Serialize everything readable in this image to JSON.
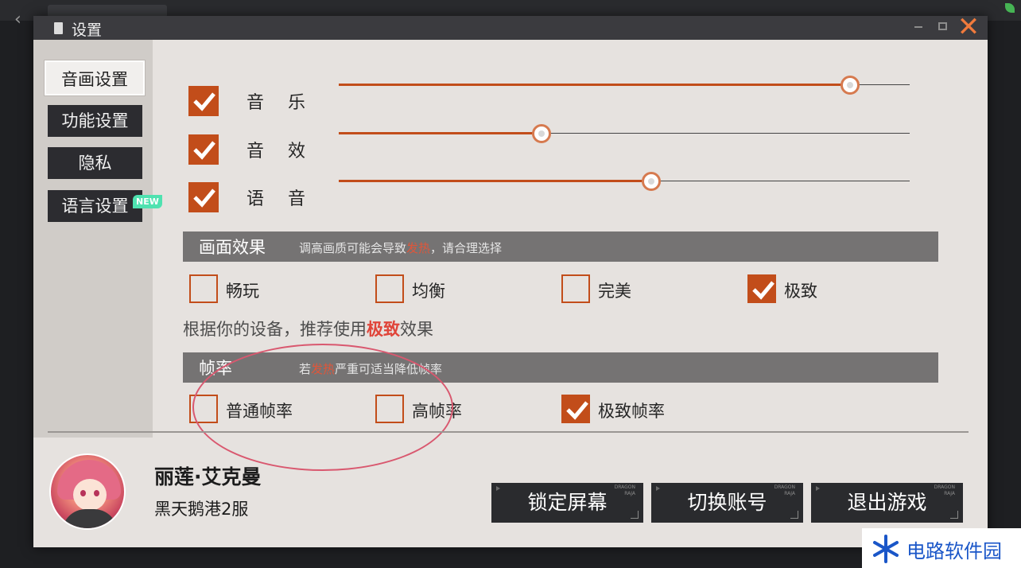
{
  "window": {
    "title": "设置"
  },
  "sidebar": {
    "items": [
      {
        "label": "音画设置",
        "active": true
      },
      {
        "label": "功能设置",
        "active": false
      },
      {
        "label": "隐私",
        "active": false
      },
      {
        "label": "语言设置",
        "active": false
      }
    ],
    "new_badge": "NEW"
  },
  "volume": [
    {
      "label": "音乐",
      "checked": true,
      "level": 0.895
    },
    {
      "label": "音效",
      "checked": true,
      "level": 0.355
    },
    {
      "label": "语音",
      "checked": true,
      "level": 0.548
    }
  ],
  "quality": {
    "title": "画面效果",
    "hint_before": "调高画质可能会导致",
    "hint_hot": "发热",
    "hint_after": "，请合理选择",
    "options": [
      {
        "label": "畅玩",
        "checked": false
      },
      {
        "label": "均衡",
        "checked": false
      },
      {
        "label": "完美",
        "checked": false
      },
      {
        "label": "极致",
        "checked": true
      }
    ],
    "recommend_before": "根据你的设备，推荐使用",
    "recommend_highlight": "极致",
    "recommend_after": "效果"
  },
  "framerate": {
    "title": "帧率",
    "hint_before": "若",
    "hint_hot": "发热",
    "hint_after": "严重可适当降低帧率",
    "options": [
      {
        "label": "普通帧率",
        "checked": false
      },
      {
        "label": "高帧率",
        "checked": false
      },
      {
        "label": "极致帧率",
        "checked": true
      }
    ]
  },
  "profile": {
    "name": "丽莲·艾克曼",
    "server": "黑天鹅港2服"
  },
  "buttons": {
    "lock_screen": "锁定屏幕",
    "switch_account": "切换账号",
    "exit_game": "退出游戏",
    "brand_line1": "DRAGON",
    "brand_line2": "RAJA"
  },
  "watermark": {
    "text": "电路软件园"
  },
  "colors": {
    "accent": "#c24d1a",
    "hot_text": "#e0563a",
    "panel": "#e6e2df",
    "dark_button": "#2a2b2e",
    "section_bar": "#757373",
    "annotation": "#d9586f"
  }
}
